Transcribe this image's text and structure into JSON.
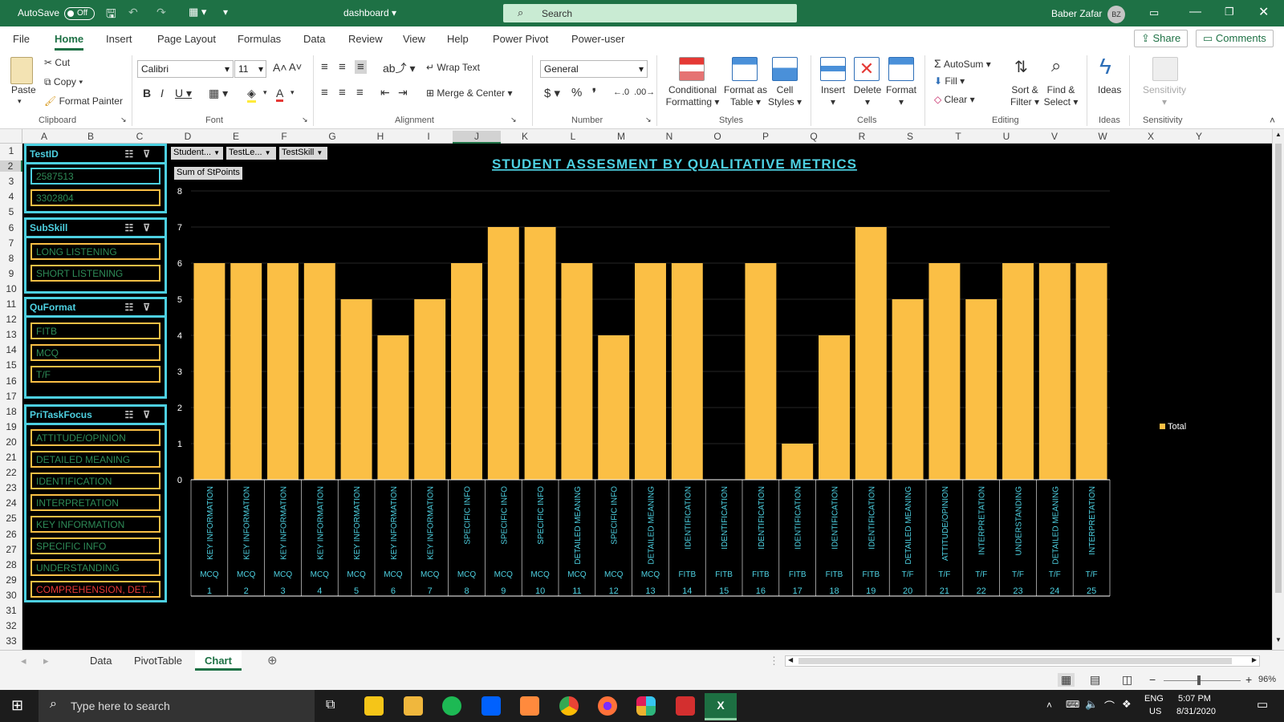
{
  "titlebar": {
    "autosave_label": "AutoSave",
    "autosave_state": "Off",
    "filename": "dashboard",
    "search_placeholder": "Search",
    "user_name": "Baber Zafar",
    "user_initials": "BZ"
  },
  "menu": {
    "items": [
      "File",
      "Home",
      "Insert",
      "Page Layout",
      "Formulas",
      "Data",
      "Review",
      "View",
      "Help",
      "Power Pivot",
      "Power-user"
    ],
    "active": "Home",
    "share_label": "Share",
    "comments_label": "Comments"
  },
  "ribbon": {
    "paste": "Paste",
    "cut": "Cut",
    "copy": "Copy",
    "format_painter": "Format Painter",
    "font_name": "Calibri",
    "font_size": "11",
    "wrap_text": "Wrap Text",
    "merge_center": "Merge & Center",
    "number_format": "General",
    "conditional_formatting": [
      "Conditional",
      "Formatting"
    ],
    "format_as_table": [
      "Format as",
      "Table"
    ],
    "cell_styles": [
      "Cell",
      "Styles"
    ],
    "insert": "Insert",
    "delete": "Delete",
    "format": "Format",
    "autosum": "AutoSum",
    "fill": "Fill",
    "clear": "Clear",
    "sort_filter": [
      "Sort &",
      "Filter"
    ],
    "find_select": [
      "Find &",
      "Select"
    ],
    "ideas": "Ideas",
    "sensitivity": "Sensitivity",
    "groups": [
      "Clipboard",
      "Font",
      "Alignment",
      "Number",
      "Styles",
      "Cells",
      "Editing",
      "Ideas",
      "Sensitivity"
    ]
  },
  "columns": [
    "A",
    "B",
    "C",
    "D",
    "E",
    "F",
    "G",
    "H",
    "I",
    "J",
    "K",
    "L",
    "M",
    "N",
    "O",
    "P",
    "Q",
    "R",
    "S",
    "T",
    "U",
    "V",
    "W",
    "X",
    "Y"
  ],
  "rows": [
    "1",
    "2",
    "3",
    "4",
    "5",
    "6",
    "7",
    "8",
    "9",
    "10",
    "11",
    "12",
    "13",
    "14",
    "15",
    "16",
    "17",
    "18",
    "19",
    "20",
    "21",
    "22",
    "23",
    "24",
    "25",
    "26",
    "27",
    "28",
    "29",
    "30",
    "31",
    "32",
    "33"
  ],
  "slicers": {
    "testid": {
      "title": "TestID",
      "items": [
        "2587513",
        "3302804"
      ]
    },
    "subskill": {
      "title": "SubSkill",
      "items": [
        "LONG LISTENING",
        "SHORT LISTENING"
      ]
    },
    "quformat": {
      "title": "QuFormat",
      "items": [
        "FITB",
        "MCQ",
        "T/F"
      ]
    },
    "pritaskfocus": {
      "title": "PriTaskFocus",
      "items": [
        "ATTITUDE/OPINION",
        "DETAILED MEANING",
        "IDENTIFICATION",
        "INTERPRETATION",
        "KEY INFORMATION",
        "SPECIFIC INFO",
        "UNDERSTANDING",
        "COMPREHENSION, DET..."
      ]
    }
  },
  "pivot": {
    "filter_buttons": [
      "Student...",
      "TestLe...",
      "TestSkill"
    ],
    "value_button": "Sum of StPoints"
  },
  "chart_data": {
    "type": "bar",
    "title": "STUDENT ASSESMENT BY QUALITATIVE METRICS",
    "ylim": [
      0,
      8
    ],
    "yticks": [
      "0",
      "1",
      "2",
      "3",
      "4",
      "5",
      "6",
      "7",
      "8"
    ],
    "bar_color": "#fbbf45",
    "background": "#000000",
    "legend": "right",
    "grid": true,
    "series": [
      {
        "name": "Total",
        "values": [
          6,
          6,
          6,
          6,
          5,
          4,
          5,
          6,
          7,
          7,
          6,
          4,
          6,
          6,
          0,
          6,
          1,
          4,
          7,
          5,
          6,
          5,
          6,
          6,
          6
        ]
      }
    ],
    "categories": [
      {
        "focus": "KEY INFORMATION",
        "format": "MCQ",
        "n": "1"
      },
      {
        "focus": "KEY INFORMATION",
        "format": "MCQ",
        "n": "2"
      },
      {
        "focus": "KEY INFORMATION",
        "format": "MCQ",
        "n": "3"
      },
      {
        "focus": "KEY INFORMATION",
        "format": "MCQ",
        "n": "4"
      },
      {
        "focus": "KEY INFORMATION",
        "format": "MCQ",
        "n": "5"
      },
      {
        "focus": "KEY INFORMATION",
        "format": "MCQ",
        "n": "6"
      },
      {
        "focus": "KEY INFORMATION",
        "format": "MCQ",
        "n": "7"
      },
      {
        "focus": "SPECIFIC INFO",
        "format": "MCQ",
        "n": "8"
      },
      {
        "focus": "SPECIFIC INFO",
        "format": "MCQ",
        "n": "9"
      },
      {
        "focus": "SPECIFIC INFO",
        "format": "MCQ",
        "n": "10"
      },
      {
        "focus": "DETAILED MEANING",
        "format": "MCQ",
        "n": "11"
      },
      {
        "focus": "SPECIFIC INFO",
        "format": "MCQ",
        "n": "12"
      },
      {
        "focus": "DETAILED MEANING",
        "format": "MCQ",
        "n": "13"
      },
      {
        "focus": "IDENTIFICATION",
        "format": "FITB",
        "n": "14"
      },
      {
        "focus": "IDENTIFICATION",
        "format": "FITB",
        "n": "15"
      },
      {
        "focus": "IDENTIFICATION",
        "format": "FITB",
        "n": "16"
      },
      {
        "focus": "IDENTIFICATION",
        "format": "FITB",
        "n": "17"
      },
      {
        "focus": "IDENTIFICATION",
        "format": "FITB",
        "n": "18"
      },
      {
        "focus": "IDENTIFICATION",
        "format": "FITB",
        "n": "19"
      },
      {
        "focus": "DETAILED MEANING",
        "format": "T/F",
        "n": "20"
      },
      {
        "focus": "ATTITUDE/OPINION",
        "format": "T/F",
        "n": "21"
      },
      {
        "focus": "INTERPRETATION",
        "format": "T/F",
        "n": "22"
      },
      {
        "focus": "UNDERSTANDING",
        "format": "T/F",
        "n": "23"
      },
      {
        "focus": "DETAILED MEANING",
        "format": "T/F",
        "n": "24"
      },
      {
        "focus": "INTERPRETATION",
        "format": "T/F",
        "n": "25"
      }
    ]
  },
  "sheet_tabs": [
    "Data",
    "PivotTable",
    "Chart"
  ],
  "active_tab": "Chart",
  "statusbar": {
    "zoom": "96%"
  },
  "taskbar": {
    "search_placeholder": "Type here to search",
    "lang": "ENG",
    "region": "US",
    "time": "5:07 PM",
    "date": "8/31/2020"
  }
}
